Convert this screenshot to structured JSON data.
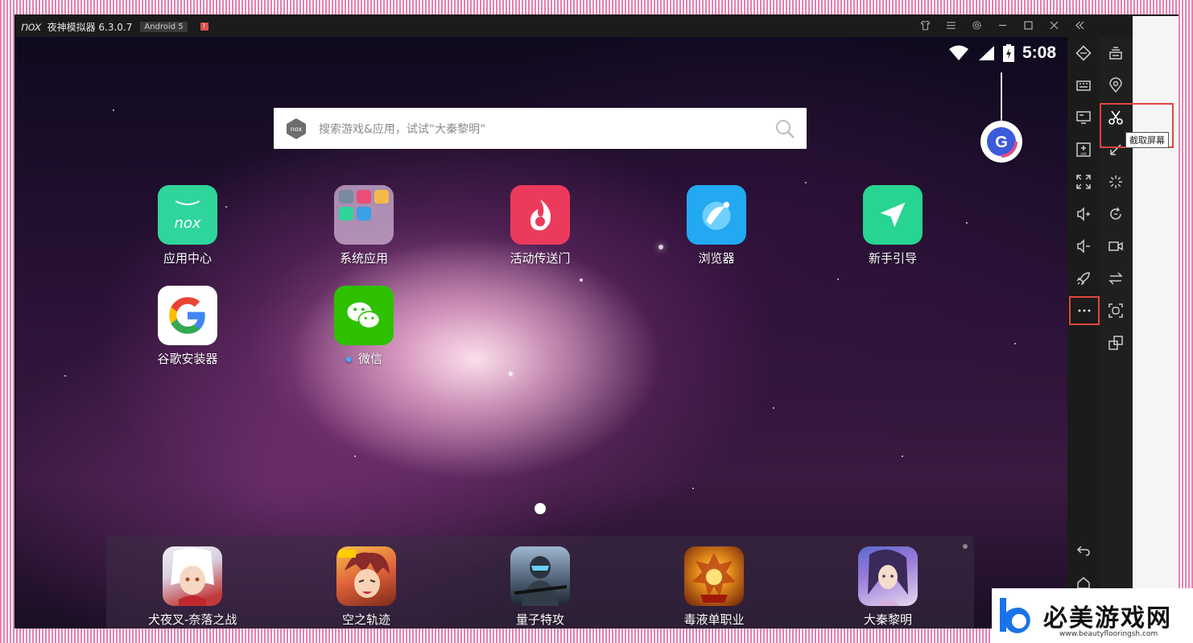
{
  "window": {
    "logo_text": "nox",
    "title": "夜神模拟器 6.3.0.7",
    "android_badge": "Android 5",
    "alert_mark": "!",
    "titlebar_icons": [
      "shirt-icon",
      "menu-icon",
      "settings-icon",
      "minimize-icon",
      "maximize-icon",
      "close-icon",
      "collapse-icon"
    ]
  },
  "status": {
    "time": "5:08"
  },
  "search": {
    "placeholder": "搜索游戏&应用，试试“大秦黎明”"
  },
  "apps": [
    {
      "label": "应用中心"
    },
    {
      "label": "系统应用"
    },
    {
      "label": "活动传送门"
    },
    {
      "label": "浏览器"
    },
    {
      "label": "新手引导"
    },
    {
      "label": "谷歌安装器"
    },
    {
      "label": "微信"
    }
  ],
  "dock": [
    {
      "label": "犬夜叉-奈落之战"
    },
    {
      "label": "空之轨迹"
    },
    {
      "label": "量子特攻"
    },
    {
      "label": "毒液单职业"
    },
    {
      "label": "大秦黎明"
    }
  ],
  "tooltip": "截取屏幕",
  "watermark": {
    "text": "必美游戏网",
    "url": "www.beautyflooringsh.com"
  },
  "colors": {
    "highlight": "#e0463f",
    "nox_green": "#2fd59b",
    "wechat_green": "#2dc100"
  }
}
